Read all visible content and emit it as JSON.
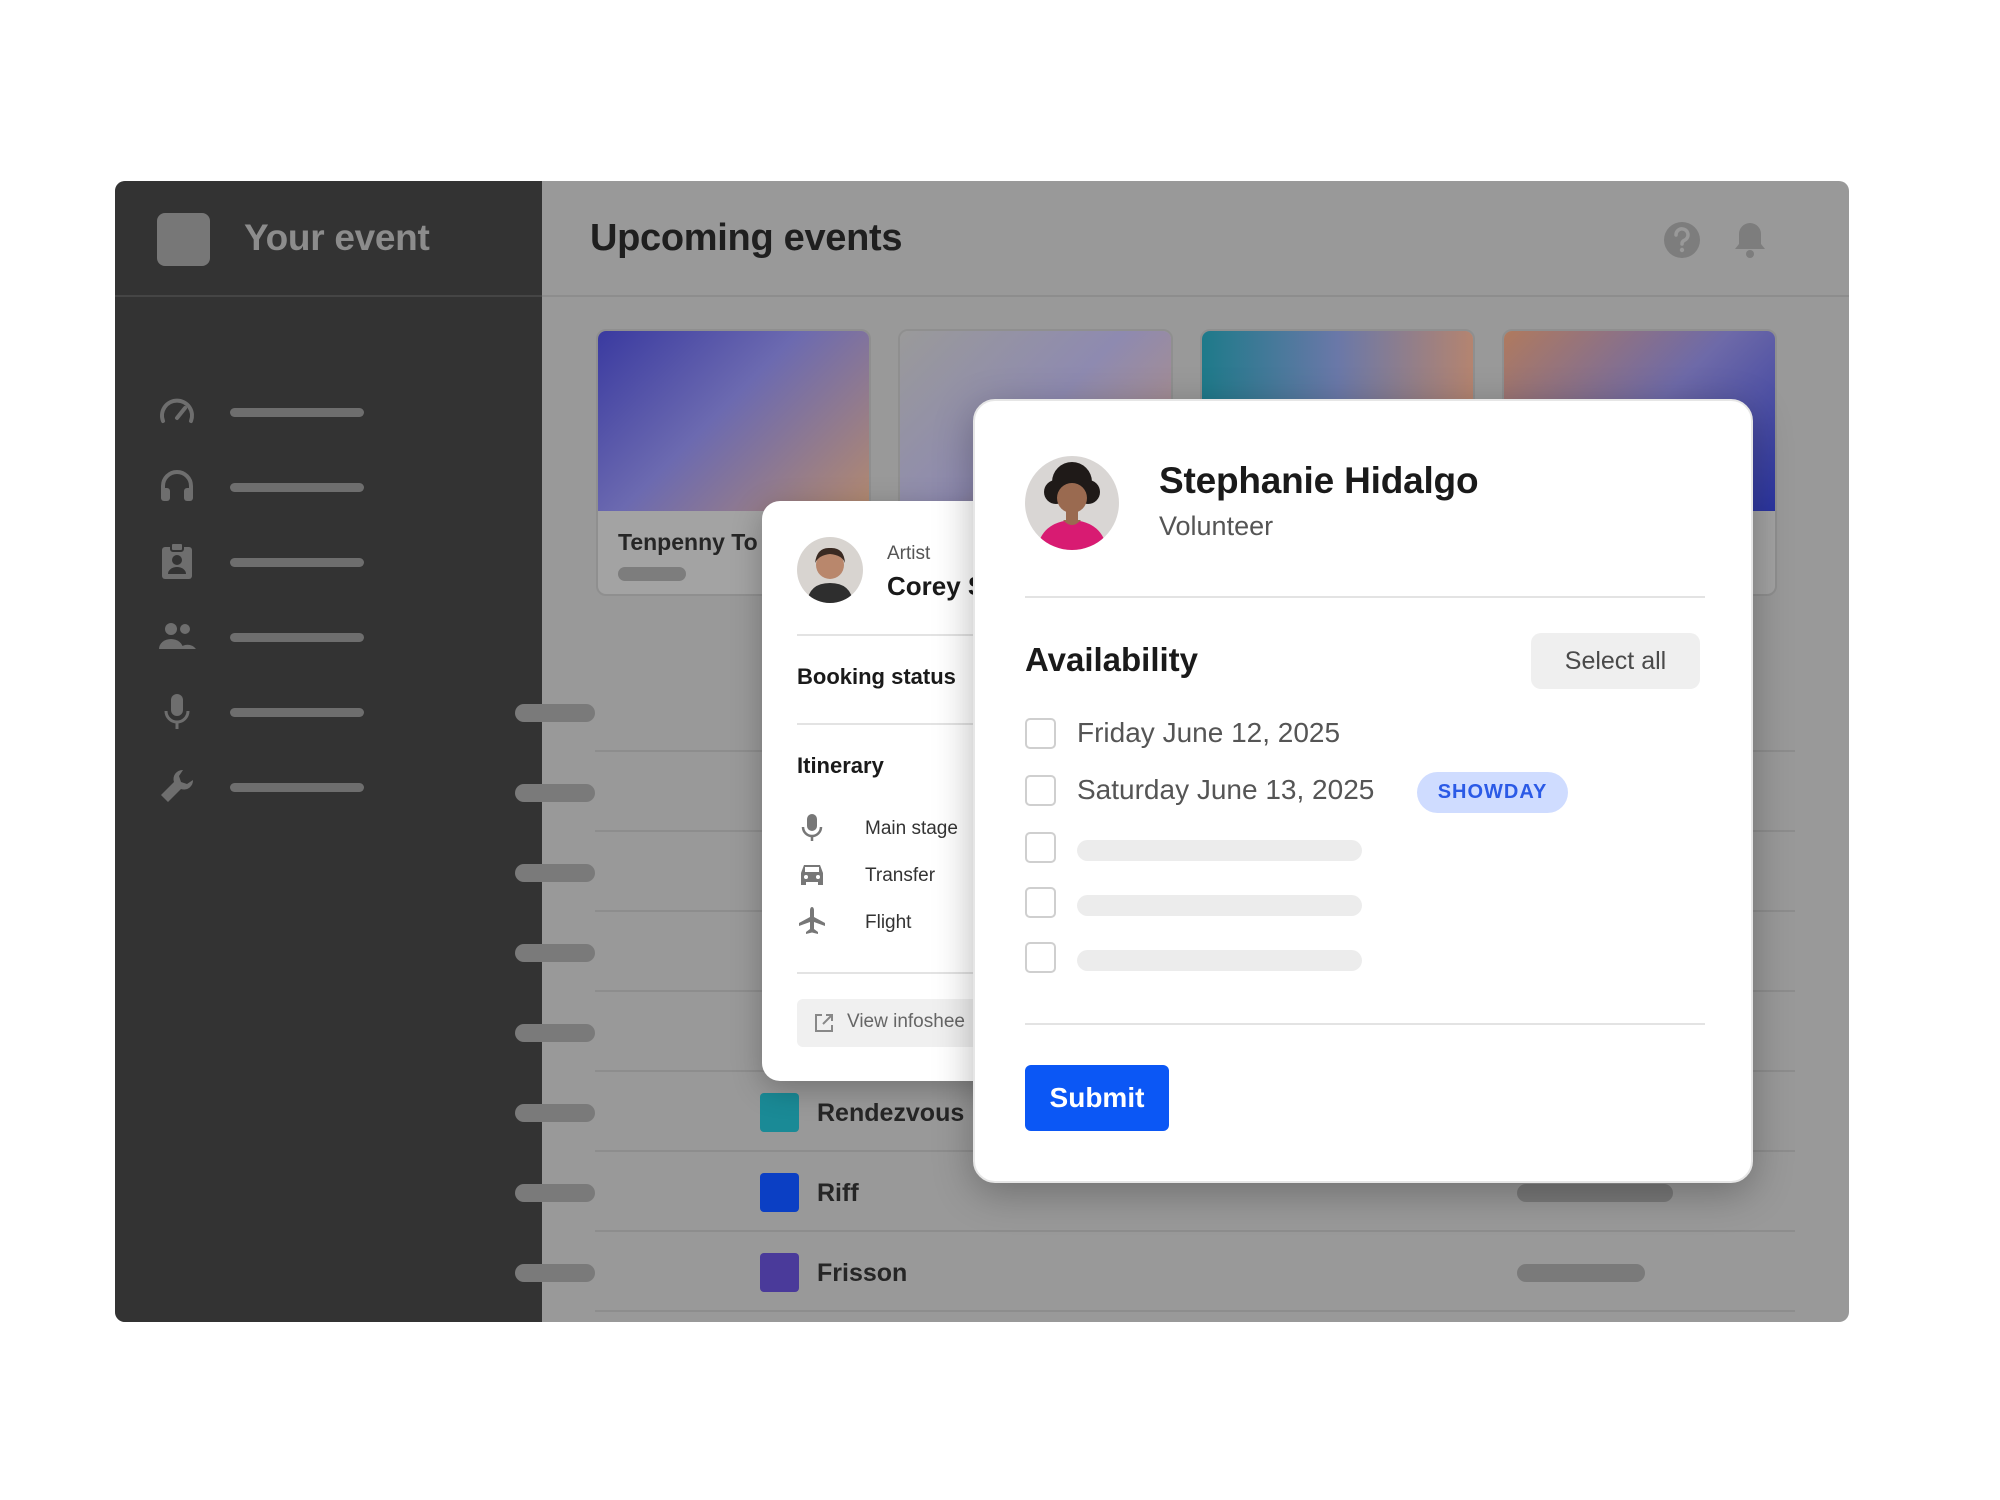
{
  "sidebar": {
    "title": "Your event",
    "nav": [
      {
        "icon": "speedometer-icon"
      },
      {
        "icon": "headset-icon"
      },
      {
        "icon": "clipboard-badge-icon"
      },
      {
        "icon": "group-icon"
      },
      {
        "icon": "microphone-icon"
      },
      {
        "icon": "wrench-icon"
      }
    ]
  },
  "header": {
    "title": "Upcoming events",
    "help_icon": "help-circle-icon",
    "bell_icon": "bell-icon"
  },
  "cards": [
    {
      "title": "Tenpenny To"
    },
    {
      "title": ""
    },
    {
      "title": ""
    },
    {
      "title": ""
    }
  ],
  "rows": [
    {
      "name": "Rendezvous",
      "color": "#1a8a96"
    },
    {
      "name": "Riff",
      "color": "#0b3fc4"
    },
    {
      "name": "Frisson",
      "color": "#4a3a9a"
    }
  ],
  "artist_panel": {
    "role": "Artist",
    "name": "Corey S",
    "booking_status_label": "Booking status",
    "itinerary_label": "Itinerary",
    "itinerary": [
      {
        "icon": "microphone-icon",
        "label": "Main stage"
      },
      {
        "icon": "car-icon",
        "label": "Transfer"
      },
      {
        "icon": "airplane-icon",
        "label": "Flight"
      }
    ],
    "infosheet_label": "View infoshee"
  },
  "volunteer_panel": {
    "name": "Stephanie Hidalgo",
    "role": "Volunteer",
    "availability_title": "Availability",
    "select_all_label": "Select all",
    "dates": [
      {
        "label": "Friday June 12, 2025",
        "checked": false
      },
      {
        "label": "Saturday June 13, 2025",
        "checked": false,
        "badge": "SHOWDAY"
      }
    ],
    "submit_label": "Submit"
  },
  "colors": {
    "accent": "#0b57f5",
    "badge_bg": "#cfdcff",
    "badge_text": "#2b5ae6",
    "sidebar_bg": "#333333",
    "overlay_bg": "#999999"
  }
}
